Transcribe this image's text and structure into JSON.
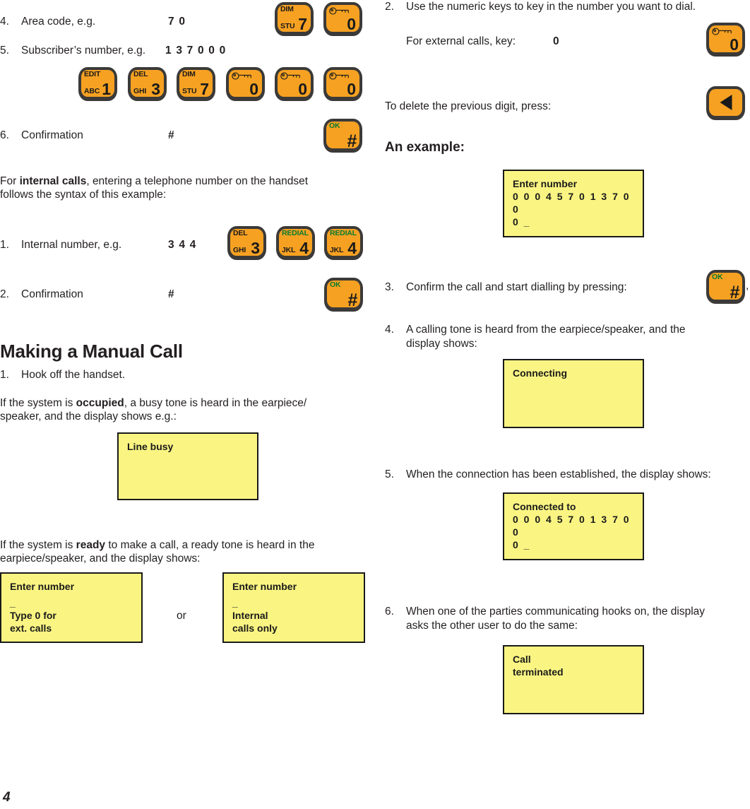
{
  "page": {
    "number": "4",
    "colors": {
      "key_face": "#F7A122",
      "key_body": "#3b3a38",
      "lcd": "#FAF583",
      "text": "#231f20",
      "green_label": "#0a7a2f"
    }
  },
  "left_column": {
    "steps_external": [
      {
        "num": "4.",
        "label": "Area code, e.g.",
        "value": "7 0"
      },
      {
        "num": "5.",
        "label": "Subscriber’s number, e.g.",
        "value": "1 3 7 0 0 0"
      },
      {
        "num": "6.",
        "label": "Confirmation",
        "value": "#"
      }
    ],
    "keys_step4": [
      {
        "icon": "dim-key",
        "top": "DIM",
        "bottom": "STU",
        "digit": "7"
      },
      {
        "icon": "key-icon",
        "top": "",
        "bottom": "",
        "digit": "0"
      }
    ],
    "keys_step5": [
      {
        "icon": "edit-key",
        "top": "EDIT",
        "bottom": "ABC",
        "digit": "1"
      },
      {
        "icon": "del-key",
        "top": "DEL",
        "bottom": "GHI",
        "digit": "3"
      },
      {
        "icon": "dim-key",
        "top": "DIM",
        "bottom": "STU",
        "digit": "7"
      },
      {
        "icon": "key-icon",
        "top": "",
        "bottom": "",
        "digit": "0"
      },
      {
        "icon": "key-icon",
        "top": "",
        "bottom": "",
        "digit": "0"
      },
      {
        "icon": "key-icon",
        "top": "",
        "bottom": "",
        "digit": "0"
      }
    ],
    "ok_key": {
      "top": "OK",
      "digit": "#"
    },
    "internal_intro": {
      "line1_pre": "For ",
      "line1_bold": "internal calls",
      "line1_post": ", entering a telephone number on the handset",
      "line2": "follows the syntax of this example:"
    },
    "steps_internal": [
      {
        "num": "1.",
        "label": "Internal number, e.g.",
        "value": "3 4 4"
      },
      {
        "num": "2.",
        "label": "Confirmation",
        "value": "#"
      }
    ],
    "keys_internal": [
      {
        "icon": "del-key",
        "top": "DEL",
        "bottom": "GHI",
        "digit": "3"
      },
      {
        "icon": "redial-key",
        "top": "REDIAL",
        "bottom": "JKL",
        "digit": "4"
      },
      {
        "icon": "redial-key",
        "top": "REDIAL",
        "bottom": "JKL",
        "digit": "4"
      }
    ],
    "heading": "Making a Manual Call",
    "step_hook": {
      "num": "1.",
      "label": "Hook off the handset."
    },
    "occupied_para": {
      "pre": "If the system is ",
      "bold": "occupied",
      "post": ", a busy tone is heard in the earpiece/",
      "line2": "speaker, and the display shows e.g.:"
    },
    "lcd_line_busy": {
      "line1": "Line busy"
    },
    "ready_para": {
      "pre": "If the system is ",
      "bold": "ready",
      "post": " to make a call, a ready tone is heard in the",
      "line2": "earpiece/speaker, and the display shows:"
    },
    "lcd_ready_a": {
      "line1": "Enter number",
      "line2": "_",
      "line3": "Type  0  for",
      "line4": "ext. calls"
    },
    "or_label": "or",
    "lcd_ready_b": {
      "line1": "Enter number",
      "line2": "_",
      "line3": "Internal",
      "line4": "calls only"
    }
  },
  "right_column": {
    "step2": {
      "num": "2.",
      "label": "Use the numeric keys to key in the number you want to dial."
    },
    "external_line": {
      "label": "For external calls, key:",
      "value": "0"
    },
    "key_zero": {
      "icon": "key-icon",
      "digit": "0"
    },
    "delete_line": "To delete the previous digit, press:",
    "key_back": {
      "icon": "left-arrow-icon"
    },
    "heading": "An example:",
    "lcd_enter_number": {
      "line1": "Enter number",
      "line2": "0 0 0 4 5 7 0 1 3 7 0 0",
      "line3": "0 _"
    },
    "step3": {
      "num": "3.",
      "label": "Confirm the call and start dialling by pressing:"
    },
    "ok_key": {
      "top": "OK",
      "digit": "#"
    },
    "ok_key_trailing": ",",
    "step4": {
      "num": "4.",
      "line1": "A calling tone is heard from the earpiece/speaker, and the",
      "line2": "display shows:"
    },
    "lcd_connecting": {
      "line1": "Connecting"
    },
    "step5": {
      "num": "5.",
      "label": "When the connection has been established, the display shows:"
    },
    "lcd_connected": {
      "line1": "Connected to",
      "line2": "0 0 0 4 5 7 0 1 3 7 0 0",
      "line3": "0 _"
    },
    "step6": {
      "num": "6.",
      "line1": "When one of the parties communicating hooks on, the display",
      "line2": "asks the other user to do the same:"
    },
    "lcd_call_terminated": {
      "line1": "Call",
      "line2": "terminated"
    }
  }
}
